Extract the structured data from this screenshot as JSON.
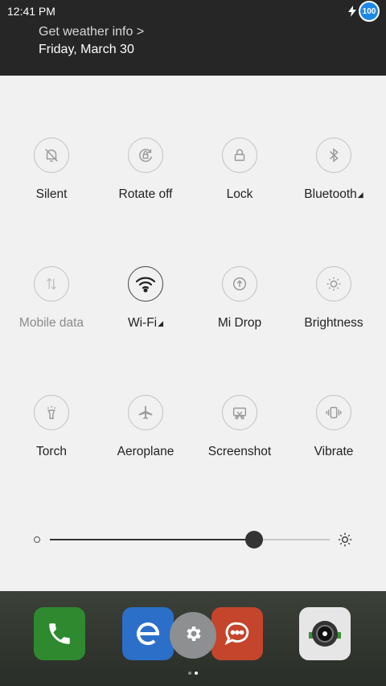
{
  "status_bar": {
    "time": "12:41 PM",
    "battery_level": "100"
  },
  "header": {
    "weather_link": "Get weather info >",
    "date": "Friday, March 30"
  },
  "toggles": [
    {
      "label": "Silent",
      "icon": "bell-off-icon",
      "active": false
    },
    {
      "label": "Rotate off",
      "icon": "rotate-lock-icon",
      "active": false
    },
    {
      "label": "Lock",
      "icon": "lock-icon",
      "active": false
    },
    {
      "label": "Bluetooth",
      "icon": "bluetooth-icon",
      "active": false,
      "has_menu": true
    },
    {
      "label": "Mobile data",
      "icon": "mobile-data-icon",
      "active": false,
      "disabled": true
    },
    {
      "label": "Wi-Fi",
      "icon": "wifi-icon",
      "active": true,
      "has_menu": true
    },
    {
      "label": "Mi Drop",
      "icon": "mi-drop-icon",
      "active": false
    },
    {
      "label": "Brightness",
      "icon": "brightness-icon",
      "active": false
    },
    {
      "label": "Torch",
      "icon": "torch-icon",
      "active": false
    },
    {
      "label": "Aeroplane",
      "icon": "airplane-icon",
      "active": false
    },
    {
      "label": "Screenshot",
      "icon": "screenshot-icon",
      "active": false
    },
    {
      "label": "Vibrate",
      "icon": "vibrate-icon",
      "active": false
    }
  ],
  "brightness": {
    "level": 0.73
  },
  "dock": {
    "apps": [
      "phone-icon",
      "browser-icon",
      "messages-icon",
      "camera-icon"
    ],
    "page_count": 2,
    "current_page": 2
  },
  "colors": {
    "panel_bg": "#f1f1f1",
    "header_bg": "#262626",
    "accent_on": "#333333",
    "battery": "#1e88e5"
  }
}
